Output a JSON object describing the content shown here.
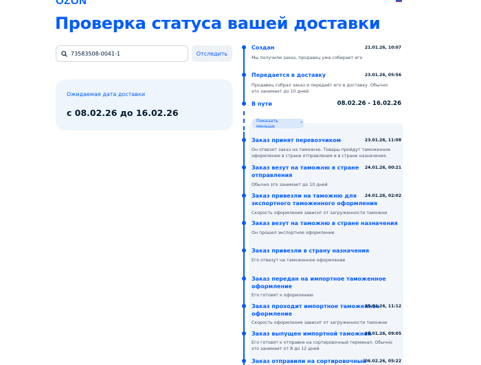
{
  "header": {
    "logo": "OZON"
  },
  "page_title": "Проверка статуса вашей доставки",
  "search": {
    "value": "73583508-0041-1",
    "button_label": "Отследить"
  },
  "delivery": {
    "label": "Ожидаемая дата доставки",
    "range": "с 08.02.26 до 16.02.26"
  },
  "show_less_label": "Показать меньше",
  "events": [
    {
      "title_lines": [
        "Создан"
      ],
      "date": "21.01.26, 10:07",
      "desc": "Мы получили заказ, продавец уже собирает его"
    },
    {
      "title_lines": [
        "Передается в доставку"
      ],
      "date": "23.01.26, 05:56",
      "desc": "Продавец собрал заказ и передаёт его в доставку. Обычно это занимает до 10 дней"
    },
    {
      "title_lines": [
        "В пути"
      ],
      "date": "08.02.26 - 16.02.26",
      "desc": ""
    },
    {
      "title_lines": [
        "Заказ принят перевозчиком"
      ],
      "date": "23.01.26, 11:08",
      "desc": "Он отвезет заказ на таможню. Товары пройдут таможенное оформление в стране отправления и в стране назначения."
    },
    {
      "title_lines": [
        "Заказ везут на таможню в стране",
        "отправления"
      ],
      "date": "24.01.26, 00:21",
      "desc": "Обычно это занимает до 10 дней"
    },
    {
      "title_lines": [
        "Заказ привезли на таможню для",
        "экспортного таможенного оформления"
      ],
      "date": "24.01.26, 02:02",
      "desc": "Скорость оформления зависит от загруженности таможни"
    },
    {
      "title_lines": [
        "Заказ везут на таможню в стране назначения"
      ],
      "date": "",
      "desc": "Он прошел экспортное оформление"
    },
    {
      "title_lines": [
        "Заказ привезли в страну назначения"
      ],
      "date": "",
      "desc": "Его отвезут на таможенное оформление"
    },
    {
      "title_lines": [
        "Заказ передан на импортное таможенное",
        "оформление"
      ],
      "date": "",
      "desc": "Его готовят к оформлению"
    },
    {
      "title_lines": [
        "Заказ проходит импортное таможенное",
        "оформление"
      ],
      "date": "25.01.26, 11:12",
      "desc": "Скорость оформления зависит от загруженности таможни"
    },
    {
      "title_lines": [
        "Заказ выпущен импортной таможней"
      ],
      "date": "28.01.26, 09:05",
      "desc": "Его готовят к отправке на сортировочный терминал. Обычно это занимает от 8 до 12 дней"
    },
    {
      "title_lines": [
        "Заказ отправили на сортировочный"
      ],
      "date": "06.02.26, 05:22",
      "desc": ""
    }
  ],
  "colors": {
    "accent": "#005bff",
    "text": "#001a34",
    "card_bg": "#eef5fc",
    "panel_bg": "#f2f6fb"
  }
}
